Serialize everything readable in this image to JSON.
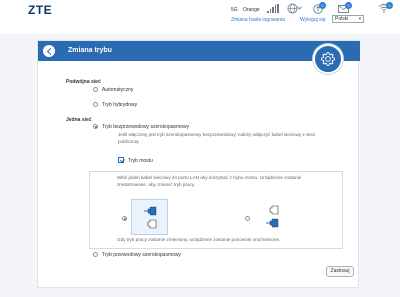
{
  "header": {
    "logo": "ZTE",
    "network": "5G",
    "operator": "Orange",
    "usb_badge": "0",
    "mail_badge": "0",
    "wifi_badge": "0",
    "change_password": "Zmiana hasła logowania",
    "logout": "Wyloguj się",
    "language": "Polski"
  },
  "page": {
    "title": "Zmiana trybu"
  },
  "dual_network": {
    "heading": "Podwójna sieć",
    "options": [
      "Automatyczny",
      "Tryb hybrydowy"
    ]
  },
  "single_network": {
    "heading": "Jedna sieć",
    "wireless_option": "Tryb bezprzewodowy szerokopasmowy",
    "wireless_note": "Jeśli włączony jest tryb szerokopasmowy bezprzewodowy, należy odłączyć kabel sieciowy z sieci publicznej.",
    "bridge_label": "Tryb mostu",
    "bridge_checked": true,
    "bridge_instruction": "Włóż jeden kabel sieciowy do portu LAN aby korzystać z trybu mostu. Urządzenie zostanie zrestartowane, aby zmienić tryb pracy.",
    "bridge_restart_note": "Gdy tryb pracy zostanie zmieniony, urządzenie zostanie ponownie uruchomione.",
    "wired_option": "Tryb przewodowy szerokopasmowy"
  },
  "actions": {
    "apply": "Zastosuj"
  },
  "colors": {
    "accent": "#2b6bb3",
    "link": "#2a7cd4",
    "logo": "#0c3a6b"
  }
}
